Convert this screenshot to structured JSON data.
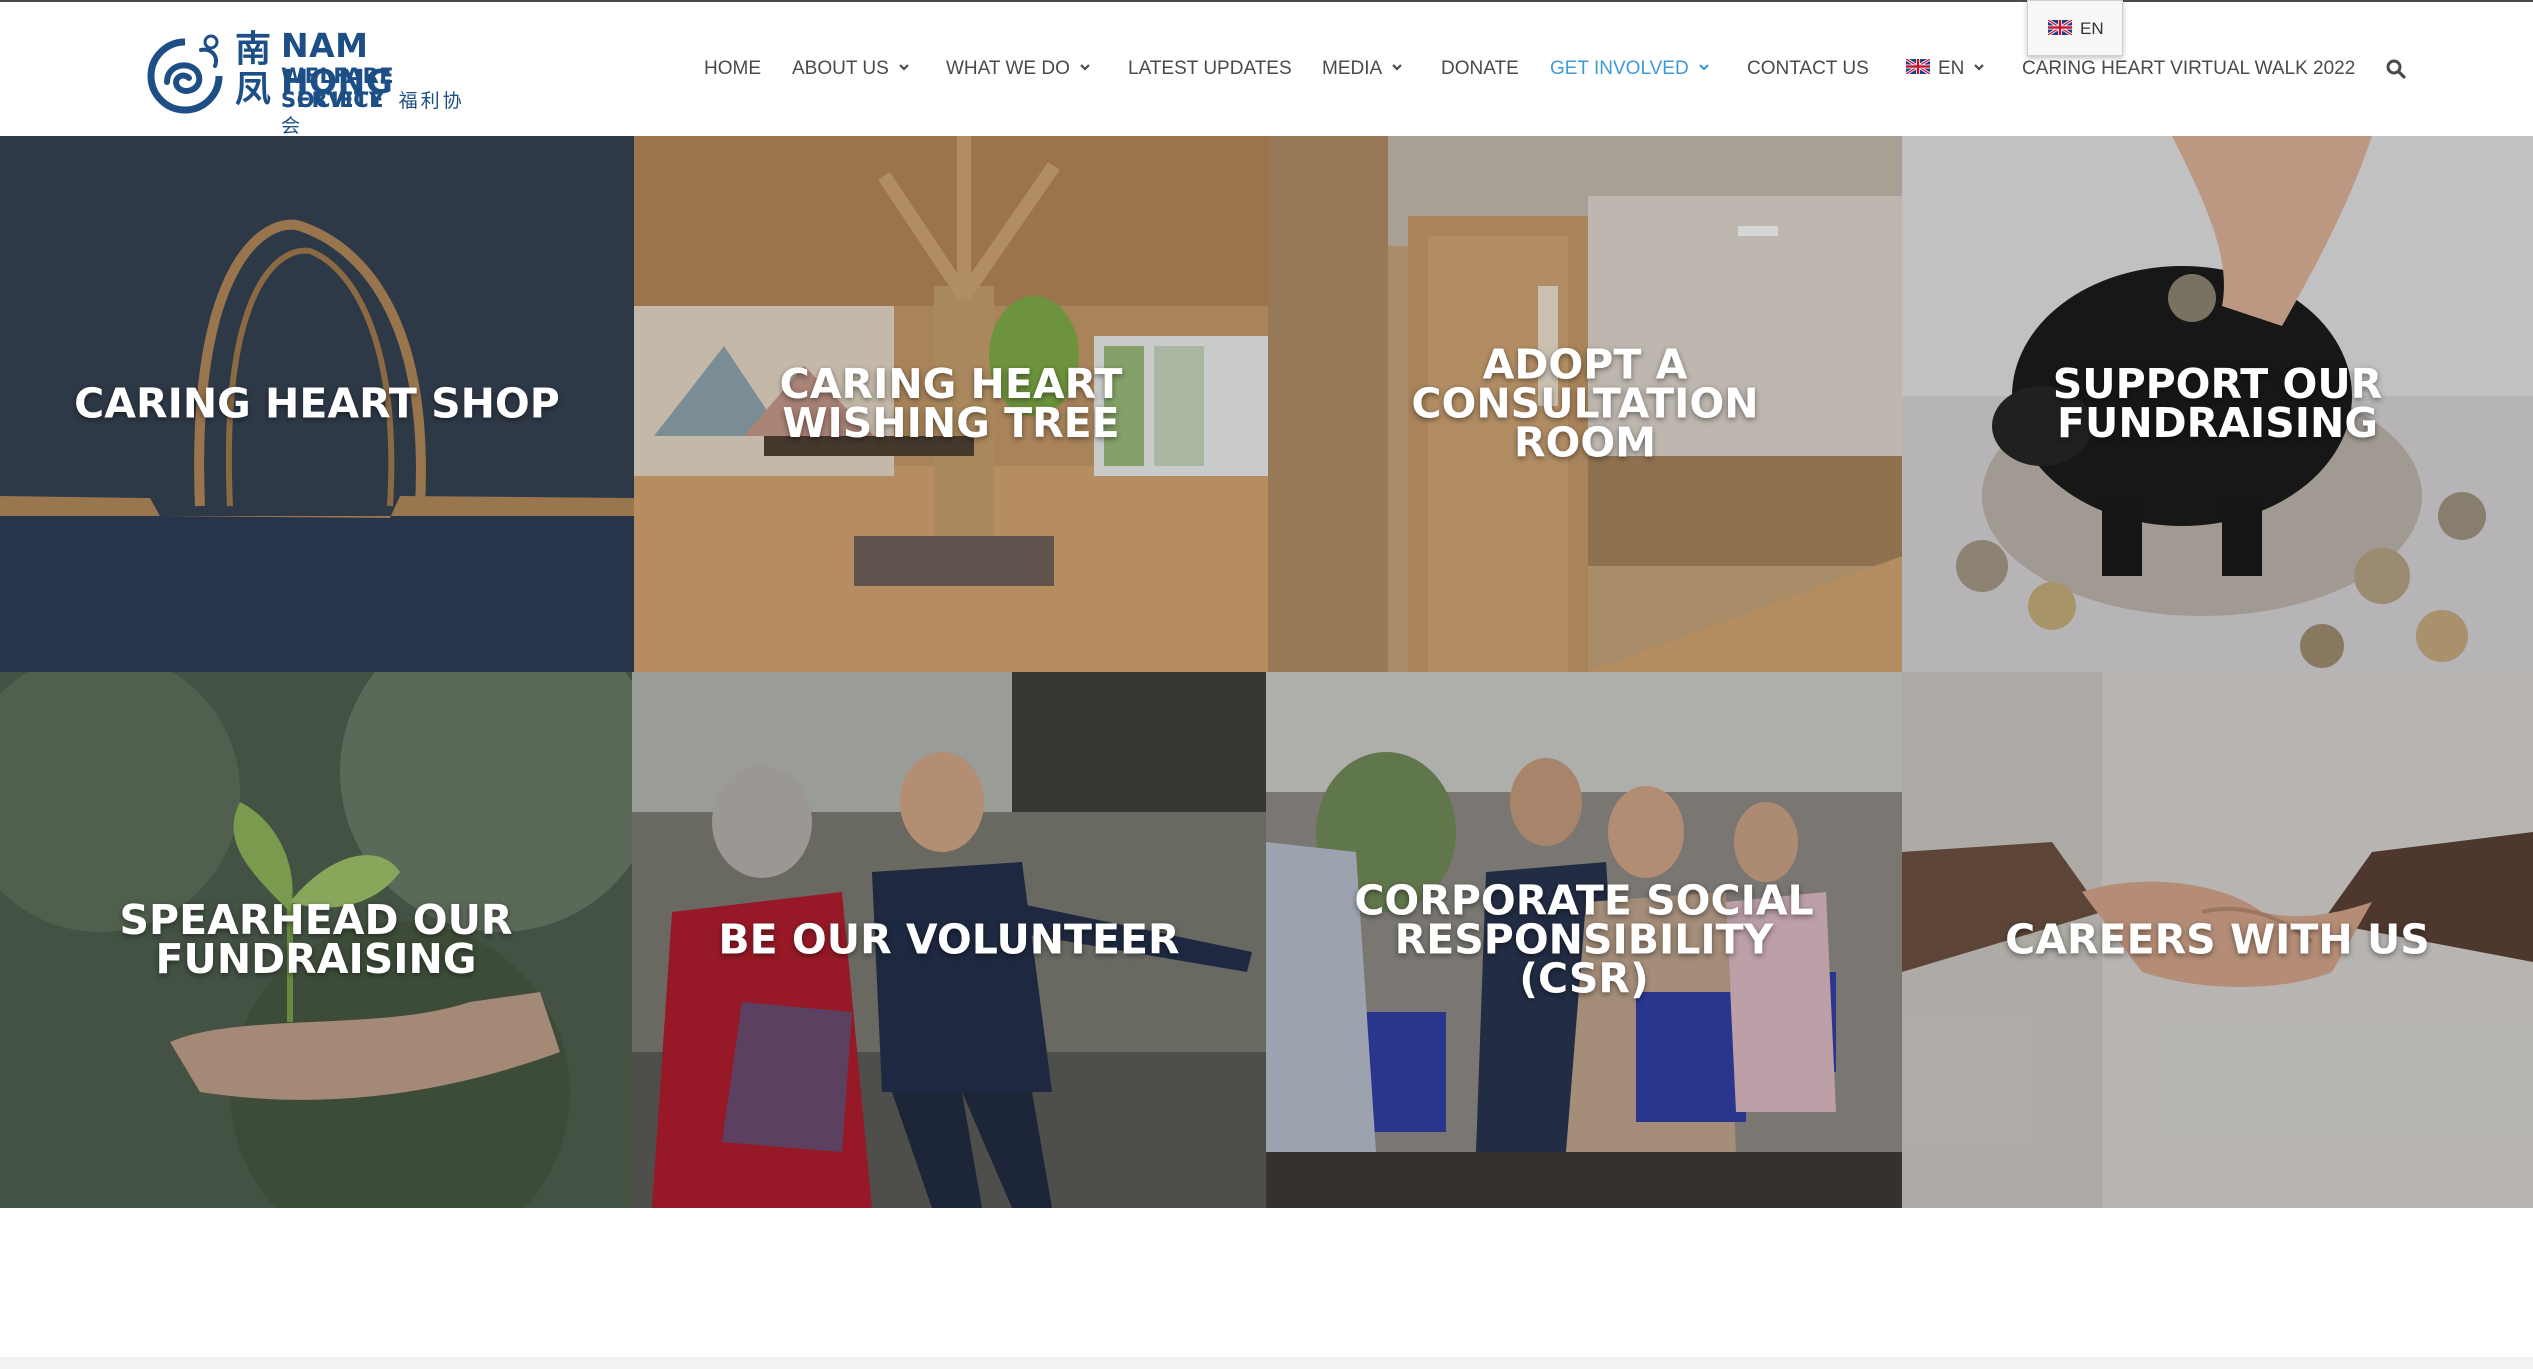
{
  "logo": {
    "name_line1": "NAM HONG",
    "name_line2": "WELFARE SERVICE",
    "name_line3": "SOCIETY",
    "chinese_short": "南凤",
    "chinese_full": "福利协会",
    "icon": "swirl-logo-icon",
    "brand_color": "#1d4f86"
  },
  "nav": {
    "items": [
      {
        "label": "HOME",
        "has_dropdown": false
      },
      {
        "label": "ABOUT US",
        "has_dropdown": true
      },
      {
        "label": "WHAT WE DO",
        "has_dropdown": true
      },
      {
        "label": "LATEST UPDATES",
        "has_dropdown": false
      },
      {
        "label": "MEDIA",
        "has_dropdown": true
      },
      {
        "label": "DONATE",
        "has_dropdown": false
      },
      {
        "label": "GET INVOLVED",
        "has_dropdown": true,
        "active": true
      },
      {
        "label": "CONTACT US",
        "has_dropdown": false
      },
      {
        "label": "EN",
        "has_dropdown": true,
        "flag": "uk-flag-icon"
      },
      {
        "label": "CARING HEART VIRTUAL WALK 2022",
        "has_dropdown": false
      }
    ],
    "active_color": "#3f9ad8",
    "text_color": "#4a4a4a",
    "search_icon": "search-icon"
  },
  "language_popup": {
    "label": "EN",
    "flag": "uk-flag-icon"
  },
  "tiles": [
    {
      "label": "CARING HEART SHOP"
    },
    {
      "label": "CARING HEART\nWISHING TREE"
    },
    {
      "label": "ADOPT A\nCONSULTATION\nROOM"
    },
    {
      "label": "SUPPORT OUR\nFUNDRAISING"
    },
    {
      "label": "SPEARHEAD OUR\nFUNDRAISING"
    },
    {
      "label": "BE OUR VOLUNTEER"
    },
    {
      "label": "CORPORATE SOCIAL\nRESPONSIBILITY (CSR)"
    },
    {
      "label": "CAREERS WITH US"
    }
  ]
}
